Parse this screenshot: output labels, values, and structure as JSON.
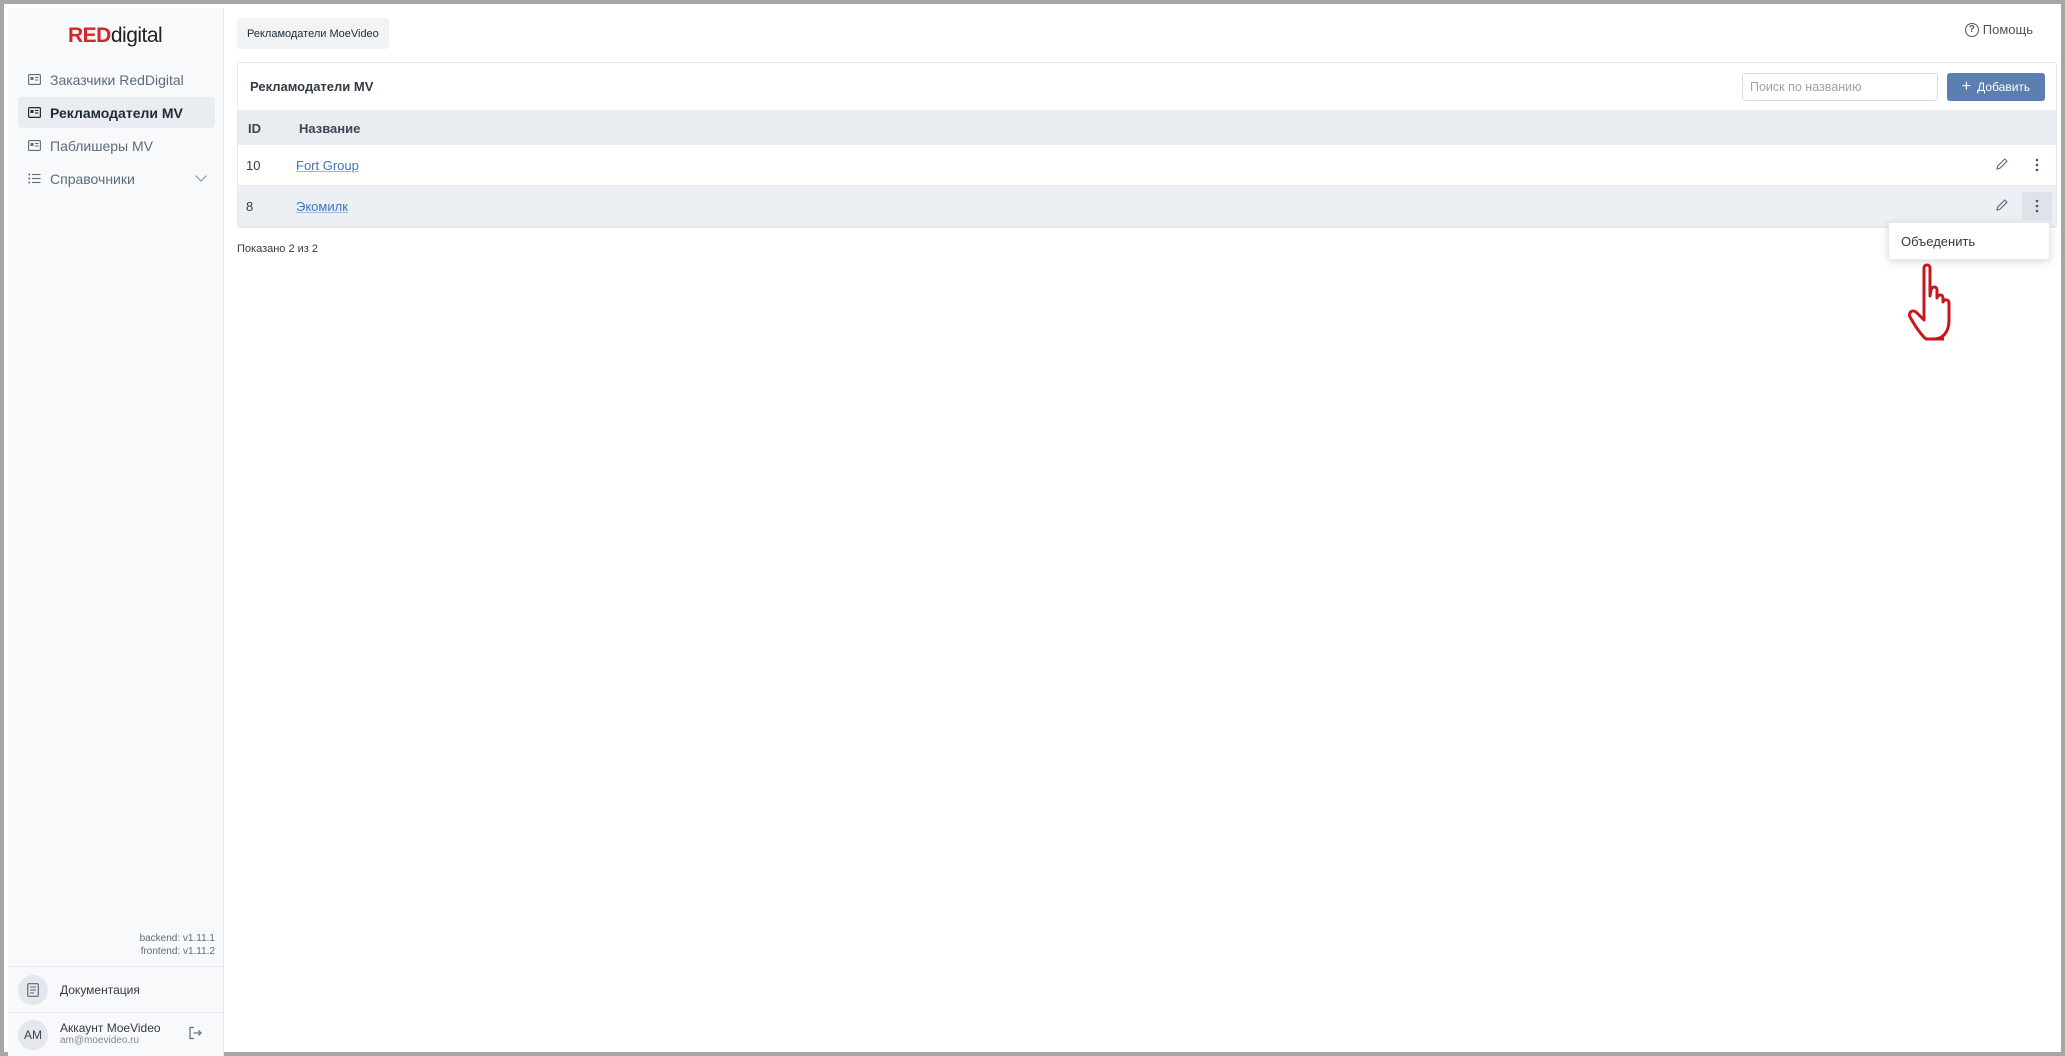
{
  "logo": {
    "red": "RED",
    "rest": "digital"
  },
  "sidebar": {
    "items": [
      {
        "label": "Заказчики RedDigital",
        "icon": "id-card-icon",
        "active": false
      },
      {
        "label": "Рекламодатели MV",
        "icon": "id-card-icon",
        "active": true
      },
      {
        "label": "Паблишеры MV",
        "icon": "id-card-icon",
        "active": false
      },
      {
        "label": "Справочники",
        "icon": "list-icon",
        "active": false,
        "expandable": true
      }
    ],
    "versions": {
      "backend": "backend: v1.11.1",
      "frontend": "frontend: v1.11.2"
    },
    "docs_label": "Документация",
    "account": {
      "initials": "АМ",
      "name": "Аккаунт MoeVideo",
      "email": "am@moevideo.ru"
    }
  },
  "header": {
    "breadcrumb": "Рекламодатели MoeVideo",
    "help": "Помощь"
  },
  "card": {
    "title": "Рекламодатели MV",
    "search_placeholder": "Поиск по названию",
    "add_label": "Добавить",
    "columns": {
      "id": "ID",
      "name": "Название"
    },
    "rows": [
      {
        "id": "10",
        "name": "Fort Group"
      },
      {
        "id": "8",
        "name": "Экомилк"
      }
    ],
    "shown": "Показано 2 из 2"
  },
  "context_menu": {
    "item": "Объеденить"
  },
  "colors": {
    "brand_red": "#d4262c",
    "accent": "#5b7fb0",
    "link": "#3e74c5"
  }
}
